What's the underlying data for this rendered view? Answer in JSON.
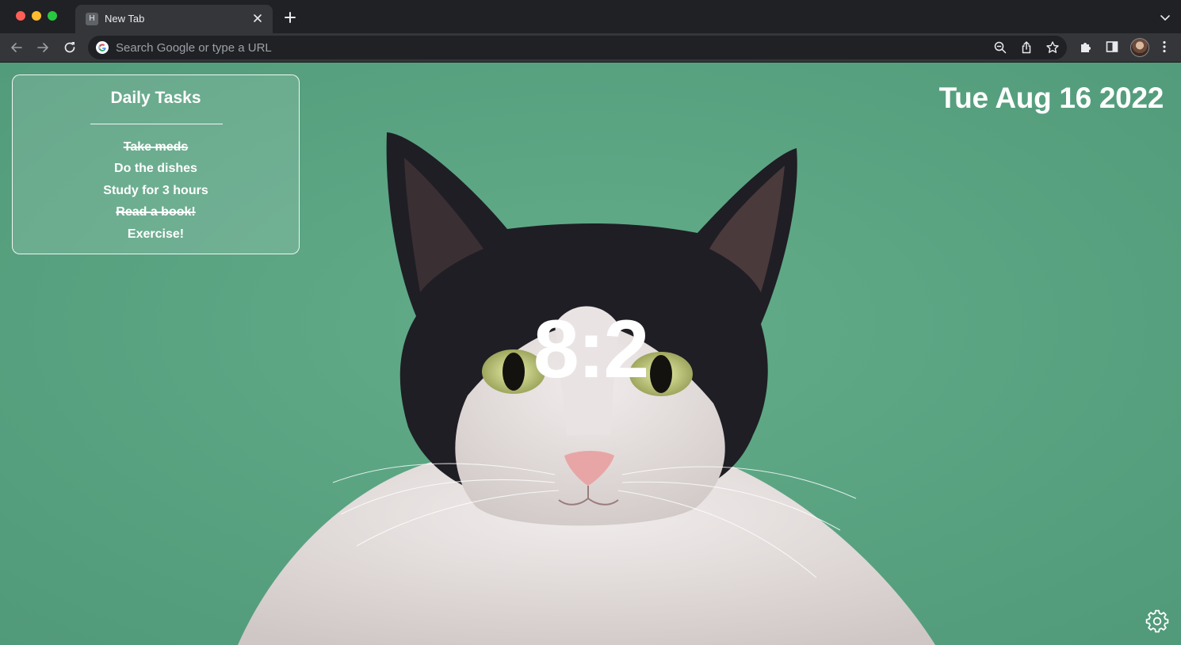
{
  "browser": {
    "tab": {
      "title": "New Tab",
      "favicon_letter": "H"
    },
    "omnibox": {
      "placeholder": "Search Google or type a URL"
    },
    "icons": {
      "back": "arrow-left-icon",
      "forward": "arrow-right-icon",
      "reload": "reload-icon",
      "zoom": "zoom-icon",
      "share": "share-icon",
      "bookmark": "star-icon",
      "extensions": "puzzle-icon",
      "side_panel": "side-panel-icon",
      "menu": "kebab-menu-icon"
    }
  },
  "page": {
    "tasks": {
      "title": "Daily Tasks",
      "items": [
        {
          "label": "Take meds",
          "done": true
        },
        {
          "label": "Do the dishes",
          "done": false
        },
        {
          "label": "Study for 3 hours",
          "done": false
        },
        {
          "label": "Read a book!",
          "done": true
        },
        {
          "label": "Exercise!",
          "done": false
        }
      ]
    },
    "date": "Tue Aug 16 2022",
    "clock": "8:2",
    "settings_icon": "gear-icon"
  },
  "colors": {
    "background_green": "#5aa381",
    "chrome_dark": "#202124",
    "chrome_toolbar": "#35363a"
  }
}
